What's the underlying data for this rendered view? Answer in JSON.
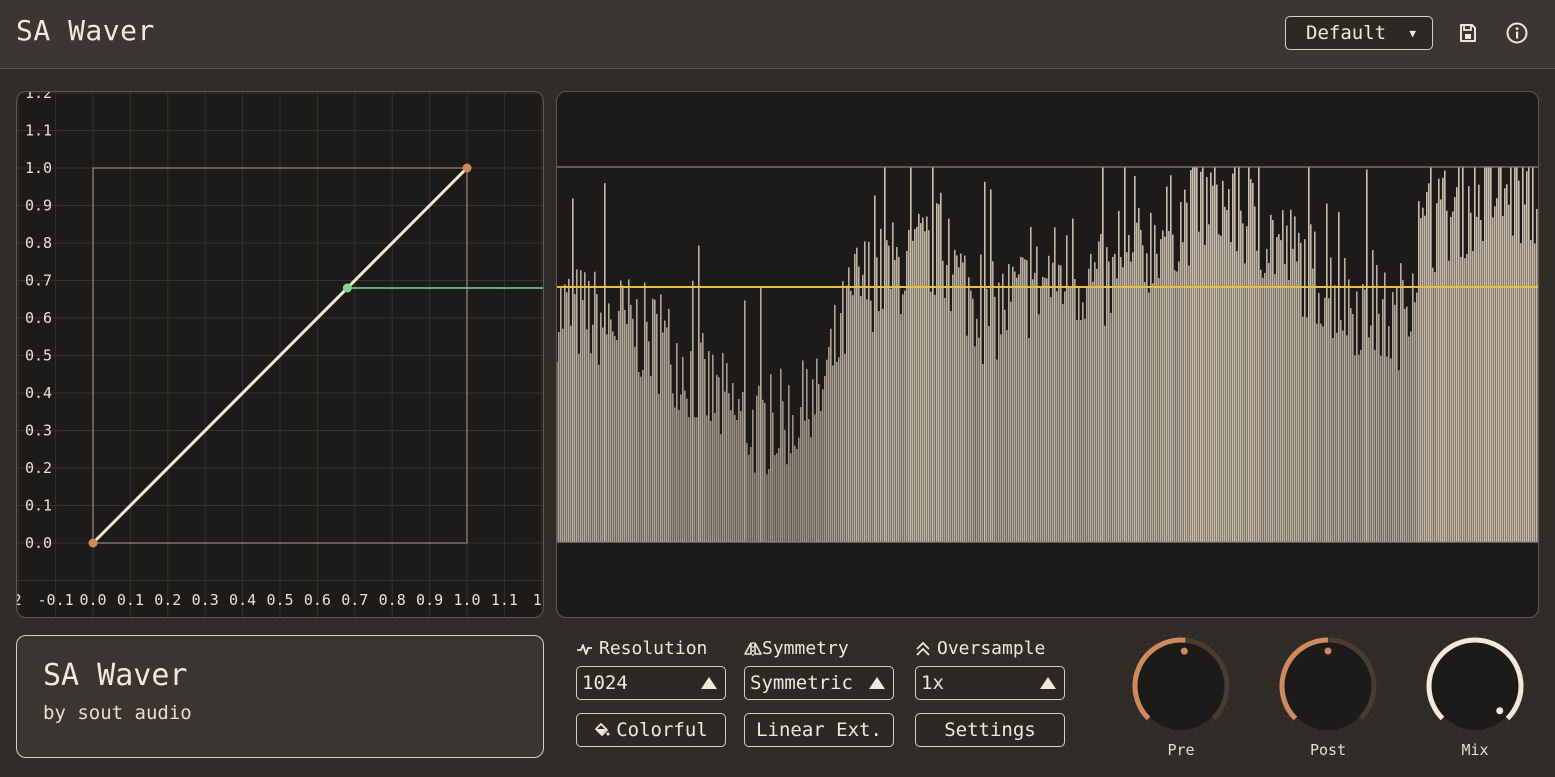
{
  "header": {
    "title": "SA Waver",
    "preset": "Default",
    "icons": [
      "save-icon",
      "info-icon"
    ]
  },
  "transfer_curve": {
    "y_ticks": [
      "1.2",
      "1.1",
      "1.0",
      "0.9",
      "0.8",
      "0.7",
      "0.6",
      "0.5",
      "0.4",
      "0.3",
      "0.2",
      "0.1",
      "0.0"
    ],
    "x_ticks": [
      ".2",
      "-0.1",
      "0.0",
      "0.1",
      "0.2",
      "0.3",
      "0.4",
      "0.5",
      "0.6",
      "0.7",
      "0.8",
      "0.9",
      "1.0",
      "1.1",
      "1."
    ],
    "points": [
      {
        "x": 0.0,
        "y": 0.0
      },
      {
        "x": 1.0,
        "y": 1.0
      }
    ],
    "current_point": {
      "x": 0.68,
      "y": 0.68
    },
    "colors": {
      "curve": "#f3e6d3",
      "endpoint": "#d08a5a",
      "current": "#7fd88f"
    }
  },
  "waveform": {
    "level": 0.68,
    "colors": {
      "level_line": "#e6c13c",
      "bars": "#cfc2b0"
    }
  },
  "info": {
    "title": "SA Waver",
    "subtitle": "by sout audio"
  },
  "controls": {
    "resolution": {
      "label": "Resolution",
      "value": "1024",
      "icon": "waveform-icon"
    },
    "symmetry": {
      "label": "Symmetry",
      "value": "Symmetric",
      "icon": "symmetry-icon"
    },
    "oversample": {
      "label": "Oversample",
      "value": "1x",
      "icon": "chevrons-up-icon"
    },
    "colorful_label": "Colorful",
    "linear_ext_label": "Linear Ext.",
    "settings_label": "Settings"
  },
  "knobs": [
    {
      "label": "Pre",
      "value": 0.52,
      "color": "#d08a5a"
    },
    {
      "label": "Post",
      "value": 0.5,
      "color": "#d08a5a"
    },
    {
      "label": "Mix",
      "value": 1.0,
      "color": "#f6e8d8"
    }
  ]
}
